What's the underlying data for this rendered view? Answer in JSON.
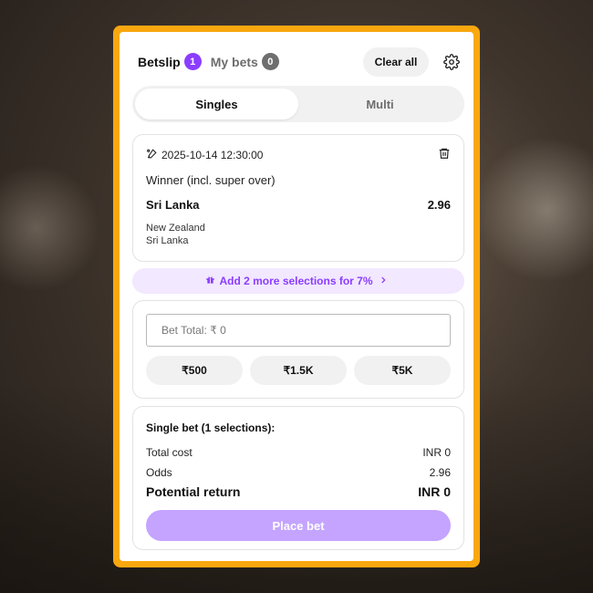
{
  "colors": {
    "accent": "#8b3dff",
    "frame": "#f8a70f",
    "place_bet_disabled": "#c4a4ff",
    "promo_bg": "#f2e8ff"
  },
  "header": {
    "betslip_label": "Betslip",
    "betslip_count": "1",
    "mybets_label": "My bets",
    "mybets_count": "0",
    "clear_all_label": "Clear all",
    "settings_icon": "gear-icon"
  },
  "tabs": [
    {
      "label": "Singles",
      "active": true
    },
    {
      "label": "Multi",
      "active": false
    }
  ],
  "selection": {
    "sport_icon": "cricket-icon",
    "datetime": "2025-10-14 12:30:00",
    "delete_icon": "trash-icon",
    "market": "Winner (incl. super over)",
    "pick": "Sri Lanka",
    "odds": "2.96",
    "team_home": "New Zealand",
    "team_away": "Sri Lanka"
  },
  "promo": {
    "icon": "gift-icon",
    "text": "Add 2 more selections for 7%",
    "chevron_icon": "chevron-right-icon"
  },
  "stake": {
    "placeholder": "Bet Total: ₹ 0",
    "quick_amounts": [
      "₹500",
      "₹1.5K",
      "₹5K"
    ]
  },
  "summary": {
    "title": "Single bet (1 selections):",
    "total_cost_label": "Total cost",
    "total_cost_value": "INR 0",
    "odds_label": "Odds",
    "odds_value": "2.96",
    "potential_return_label": "Potential return",
    "potential_return_value": "INR 0",
    "place_bet_label": "Place bet"
  }
}
